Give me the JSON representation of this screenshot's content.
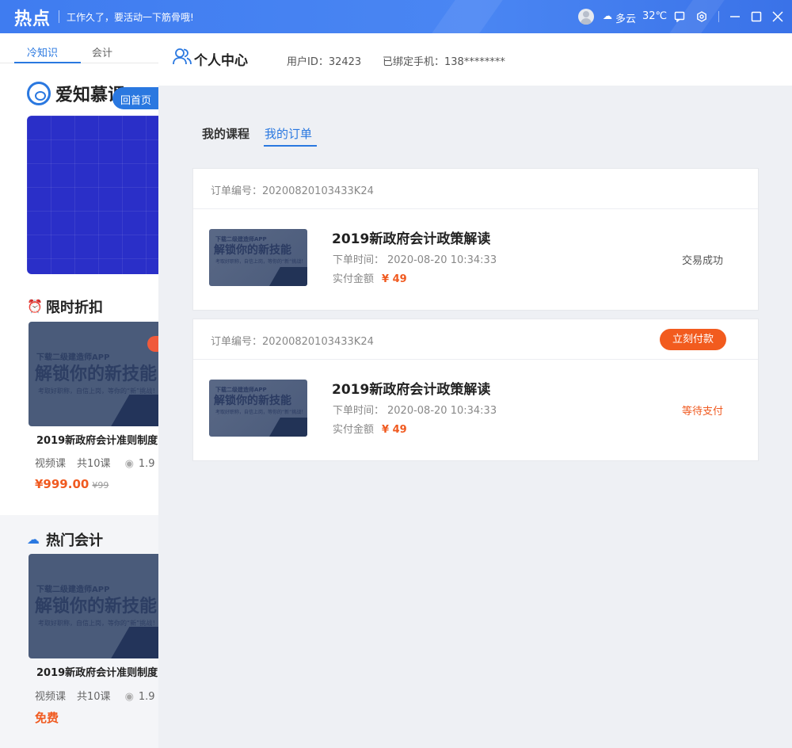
{
  "titlebar": {
    "logo": "热点",
    "slogan": "工作久了，要活动一下筋骨哦!",
    "weather": "多云",
    "temperature": "32℃"
  },
  "left_page": {
    "tabs": [
      "冷知识",
      "会计"
    ],
    "brand_name": "爱知慕课",
    "back_home": "回首页",
    "section_discount": "限时折扣",
    "section_hot": "热门会计",
    "thumb_line1": "下载二级建造师APP",
    "thumb_line2": "解锁你的新技能",
    "thumb_line3": "考取好职称，自信上岗，等你的“新”挑战！",
    "course1": {
      "title": "2019新政府会计准则制度",
      "type": "视频课",
      "lessons": "共10课",
      "views": "1.9",
      "price": "¥999.00",
      "orig_price": "¥99"
    },
    "course2": {
      "title": "2019新政府会计准则制度",
      "type": "视频课",
      "lessons": "共10课",
      "views": "1.9",
      "price": "免费"
    }
  },
  "panel": {
    "title": "个人中心",
    "user_id": "用户ID：32423",
    "phone": "已绑定手机：138********",
    "tabs": [
      "我的课程",
      "我的订单"
    ],
    "orders": [
      {
        "number": "订单编号：20200820103433K24",
        "course": "2019新政府会计政策解读",
        "time_label": "下单时间：",
        "time": "2020-08-20 10:34:33",
        "amount_label": "实付金额",
        "amount": "¥ 49",
        "status": "交易成功"
      },
      {
        "number": "订单编号：20200820103433K24",
        "pay_button": "立刻付款",
        "course": "2019新政府会计政策解读",
        "time_label": "下单时间：",
        "time": "2020-08-20 10:34:33",
        "amount_label": "实付金额",
        "amount": "¥ 49",
        "status": "等待支付"
      }
    ],
    "thumb_line1": "下载二级建造师APP",
    "thumb_line2": "解锁你的新技能",
    "thumb_line3": "考取好职称，自信上岗，等你的“新”挑战！"
  },
  "colors": {
    "accent": "#2a78e0",
    "price": "#f05a20",
    "titlebar": "#4a86f3"
  }
}
